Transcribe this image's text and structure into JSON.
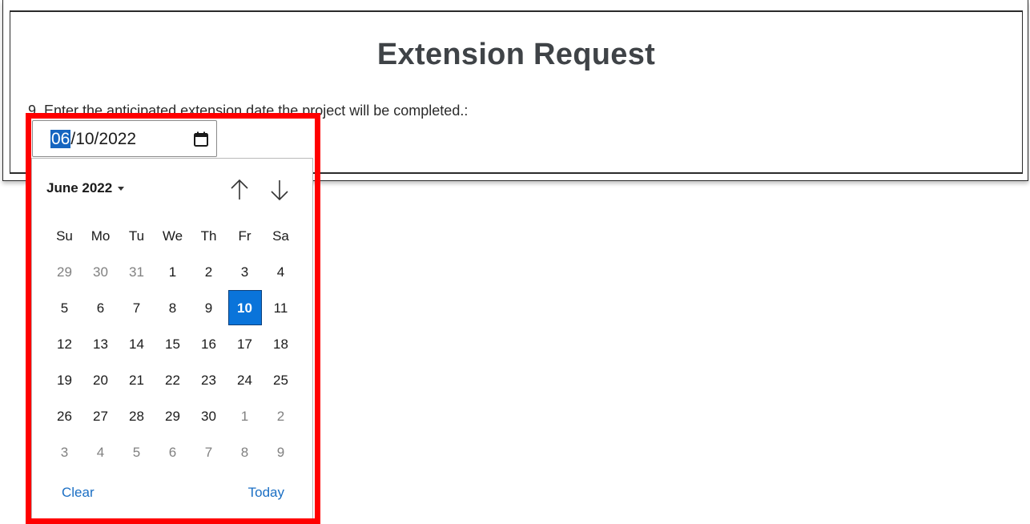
{
  "form": {
    "title": "Extension Request",
    "question": "9. Enter the anticipated extension date the project will be completed.:"
  },
  "date_input": {
    "month": "06",
    "rest": "/10/2022"
  },
  "calendar": {
    "month_label": "June 2022",
    "weekdays": [
      "Su",
      "Mo",
      "Tu",
      "We",
      "Th",
      "Fr",
      "Sa"
    ],
    "weeks": [
      [
        "29",
        "30",
        "31",
        "1",
        "2",
        "3",
        "4"
      ],
      [
        "5",
        "6",
        "7",
        "8",
        "9",
        "10",
        "11"
      ],
      [
        "12",
        "13",
        "14",
        "15",
        "16",
        "17",
        "18"
      ],
      [
        "19",
        "20",
        "21",
        "22",
        "23",
        "24",
        "25"
      ],
      [
        "26",
        "27",
        "28",
        "29",
        "30",
        "1",
        "2"
      ],
      [
        "3",
        "4",
        "5",
        "6",
        "7",
        "8",
        "9"
      ]
    ],
    "selected_day": "10",
    "clear_label": "Clear",
    "today_label": "Today"
  },
  "colors": {
    "highlight": "#ff0000",
    "selected": "#0a74da",
    "link": "#1b6fc4"
  }
}
